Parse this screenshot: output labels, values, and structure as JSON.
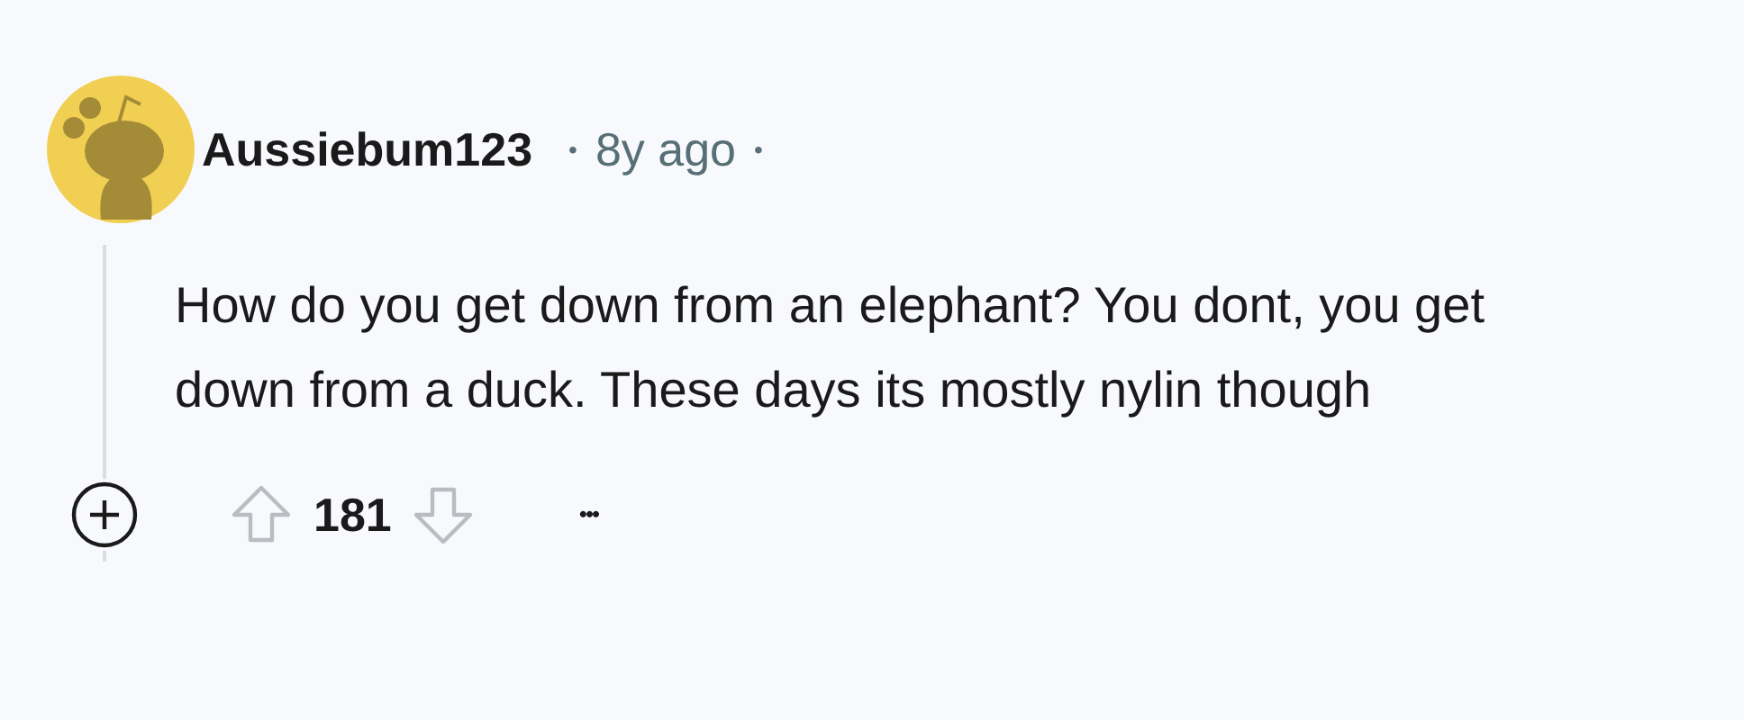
{
  "comment": {
    "author": "Aussiebum123",
    "separator_before": "•",
    "age": "8y ago",
    "separator_after": "•",
    "body": "How do you get down from an elephant? You dont, you get down from a duck. These days its mostly nylin though",
    "score": "181",
    "more": "•••"
  }
}
